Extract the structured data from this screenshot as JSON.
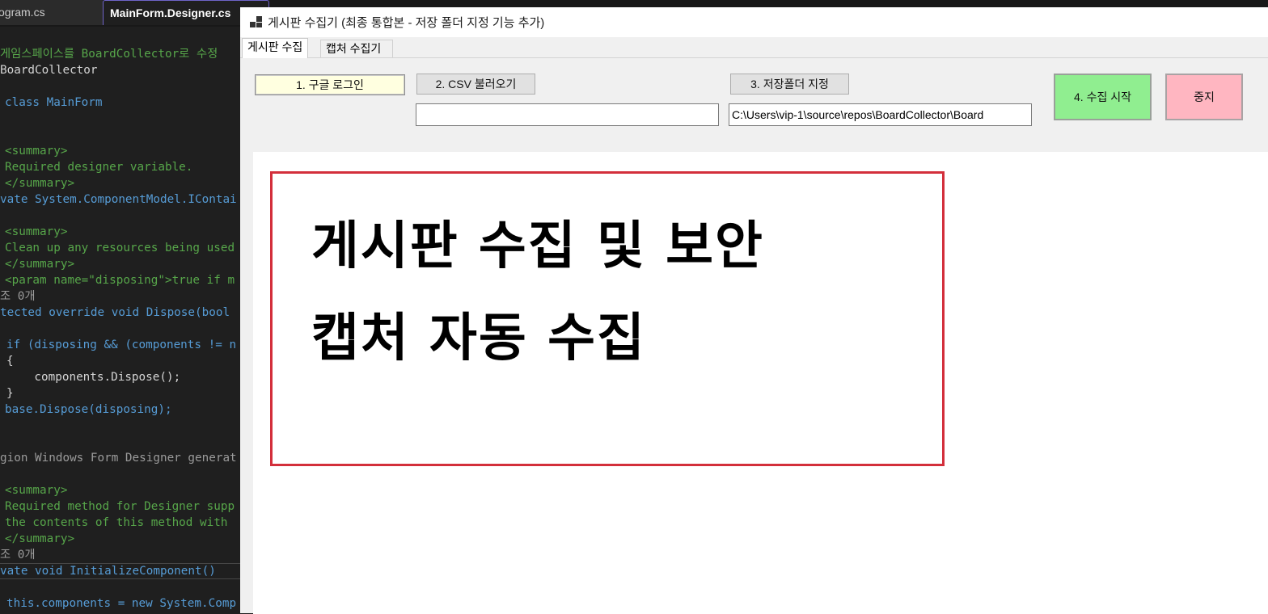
{
  "ide": {
    "tabs": [
      {
        "label": "Program.cs"
      },
      {
        "label": "MainForm.Designer.cs"
      }
    ],
    "code_lines": [
      "게임스페이스를 BoardCollector로 수정",
      "BoardCollector",
      "",
      "class MainForm",
      "",
      "<summary>",
      "Required designer variable.",
      "</summary>",
      "vate System.ComponentModel.IContai",
      "",
      "<summary>",
      "Clean up any resources being used",
      "</summary>",
      "<param name=\"disposing\">true if m",
      "조 0개",
      "tected override void Dispose(bool",
      "",
      "if (disposing && (components != n",
      "{",
      "    components.Dispose();",
      "}",
      "base.Dispose(disposing);",
      "",
      "",
      "gion Windows Form Designer generat",
      "",
      "<summary>",
      "Required method for Designer supp",
      "the contents of this method with",
      "</summary>",
      "조 0개",
      "vate void InitializeComponent()",
      "",
      "this.components = new System.Comp"
    ]
  },
  "form": {
    "title": "게시판 수집기 (최종 통합본 - 저장 폴더 지정 기능 추가)",
    "tabs": [
      {
        "label": "게시판 수집"
      },
      {
        "label": "캡처 수집기"
      }
    ],
    "buttons": {
      "google_login": "1. 구글 로그인",
      "csv_load": "2. CSV 불러오기",
      "folder_select": "3. 저장폴더 지정",
      "start": "4. 수집 시작",
      "stop": "중지"
    },
    "inputs": {
      "csv_path": "",
      "save_path": "C:\\Users\\vip-1\\source\\repos\\BoardCollector\\Board"
    },
    "headline": {
      "line1": "게시판 수집 및 보안",
      "line2": "캡처 자동 수집"
    },
    "colors": {
      "start_button": "#90ee90",
      "stop_button": "#ffb6c1",
      "login_button": "#ffffe0",
      "headline_border": "#d32f3b"
    }
  }
}
